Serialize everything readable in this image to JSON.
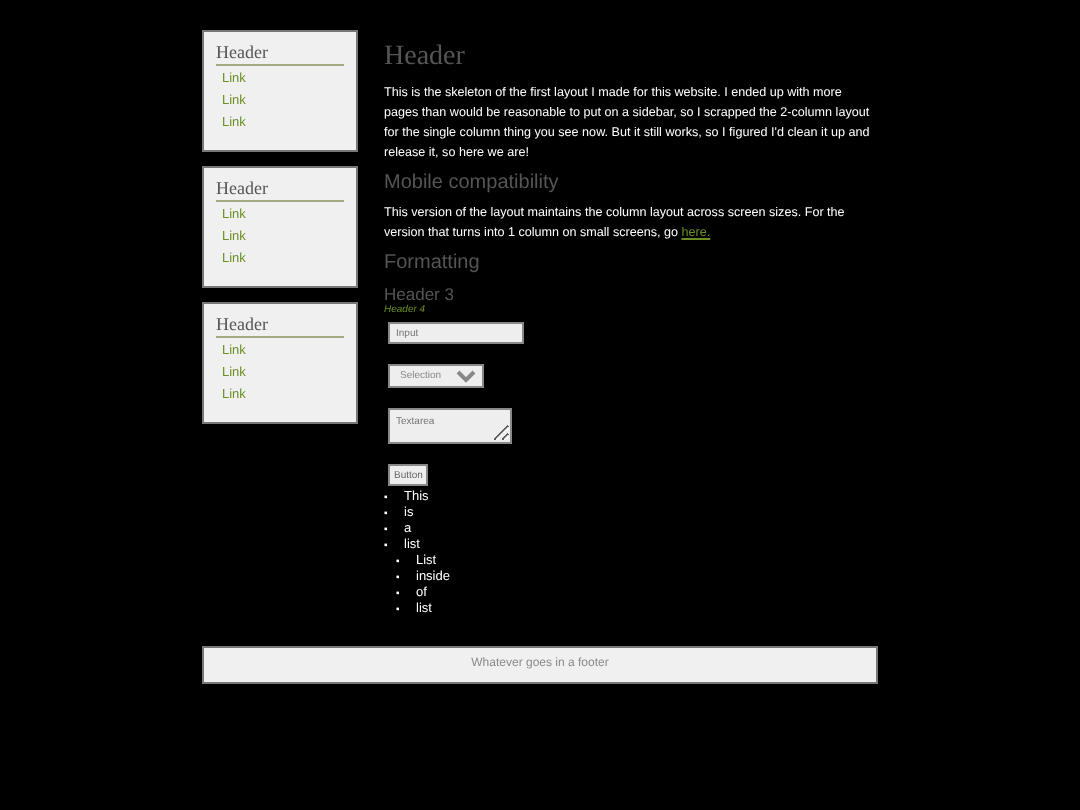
{
  "sidebar": [
    {
      "header": "Header",
      "links": [
        "Link",
        "Link",
        "Link"
      ]
    },
    {
      "header": "Header",
      "links": [
        "Link",
        "Link",
        "Link"
      ]
    },
    {
      "header": "Header",
      "links": [
        "Link",
        "Link",
        "Link"
      ]
    }
  ],
  "main": {
    "title": "Header",
    "intro": "This is the skeleton of the first layout I made for this website. I ended up with more pages than would be reasonable to put on a sidebar, so I scrapped the 2-column layout for the single column thing you see now. But it still works, so I figured I'd clean it up and release it, so here we are!",
    "h2": "Mobile compatibility",
    "para": "This version of the layout maintains the column layout across screen sizes. For the version that turns into 1 column on small screens, go ",
    "link": "here.",
    "h2b": "Formatting",
    "h3": "Header 3",
    "h4": "Header 4",
    "input": {
      "placeholder": "Input"
    },
    "select": {
      "value": "Selection"
    },
    "textarea": {
      "placeholder": "Textarea"
    },
    "button": "Button",
    "list": [
      {
        "bullet": "▪",
        "text": "This"
      },
      {
        "bullet": "▪",
        "text": "is"
      },
      {
        "bullet": "▪",
        "text": "a"
      },
      {
        "bullet": "▪",
        "text": "list",
        "children": [
          {
            "bullet": "▪",
            "text": "List"
          },
          {
            "bullet": "▪",
            "text": "inside"
          },
          {
            "bullet": "▪",
            "text": "of"
          },
          {
            "bullet": "▪",
            "text": "list"
          }
        ]
      }
    ]
  },
  "footer": "Whatever goes in a footer"
}
